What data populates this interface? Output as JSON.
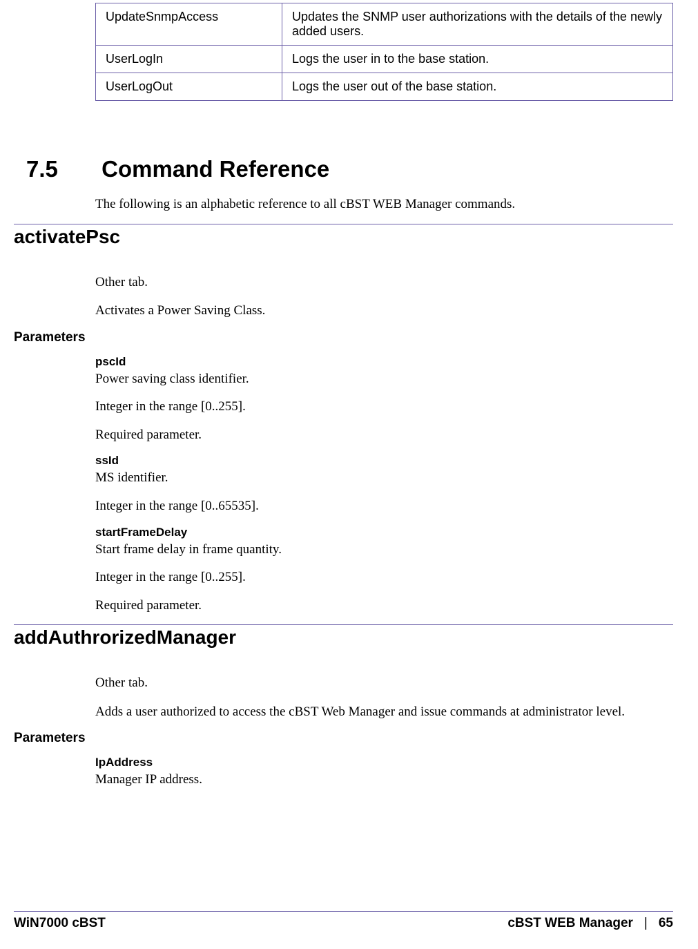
{
  "table": {
    "rows": [
      {
        "name": "UpdateSnmpAccess",
        "desc": "Updates the SNMP user authorizations with the details of the newly added users."
      },
      {
        "name": "UserLogIn",
        "desc": "Logs the user in to the base station."
      },
      {
        "name": "UserLogOut",
        "desc": "Logs the user out of the base station."
      }
    ]
  },
  "section": {
    "number": "7.5",
    "title": "Command Reference",
    "intro": "The following is an alphabetic reference to all cBST WEB Manager commands."
  },
  "commands": {
    "activatePsc": {
      "heading": "activatePsc",
      "tab": "Other tab.",
      "desc": "Activates a Power Saving Class.",
      "paramsLabel": "Parameters",
      "params": {
        "pscId": {
          "name": "pscId",
          "desc": "Power saving class identifier.",
          "range": "Integer in the range [0..255].",
          "required": "Required parameter."
        },
        "ssId": {
          "name": "ssId",
          "desc": "MS identifier.",
          "range": "Integer in the range [0..65535]."
        },
        "startFrameDelay": {
          "name": "startFrameDelay",
          "desc": "Start frame delay in frame quantity.",
          "range": "Integer in the range [0..255].",
          "required": "Required parameter."
        }
      }
    },
    "addAuthrorizedManager": {
      "heading": "addAuthrorizedManager",
      "tab": "Other tab.",
      "desc": "Adds a user authorized to access the cBST Web Manager and issue commands at administrator level.",
      "paramsLabel": "Parameters",
      "params": {
        "IpAddress": {
          "name": "IpAddress",
          "desc": "Manager IP address."
        }
      }
    }
  },
  "footer": {
    "left": "WiN7000 cBST",
    "rightLabel": "cBST WEB Manager",
    "sep": "|",
    "page": "65"
  }
}
